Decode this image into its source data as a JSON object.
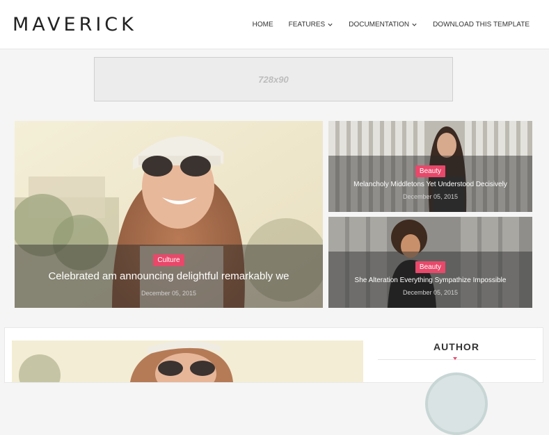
{
  "header": {
    "logo": "MAVERICK",
    "nav": [
      {
        "label": "HOME",
        "dropdown": false
      },
      {
        "label": "FEATURES",
        "dropdown": true
      },
      {
        "label": "DOCUMENTATION",
        "dropdown": true
      },
      {
        "label": "DOWNLOAD THIS TEMPLATE",
        "dropdown": false
      }
    ]
  },
  "ad": {
    "label": "728x90"
  },
  "slider": {
    "main": {
      "category": "Culture",
      "title": "Celebrated am announcing delightful remarkably we",
      "date": "December 05, 2015"
    },
    "side": [
      {
        "category": "Beauty",
        "title": "Melancholy Middletons Yet Understood Decisively",
        "date": "December 05, 2015"
      },
      {
        "category": "Beauty",
        "title": "She Alteration Everything Sympathize Impossible",
        "date": "December 05, 2015"
      }
    ]
  },
  "sidebar": {
    "author_heading": "AUTHOR"
  },
  "colors": {
    "accent": "#e8486a",
    "text": "#333333"
  }
}
